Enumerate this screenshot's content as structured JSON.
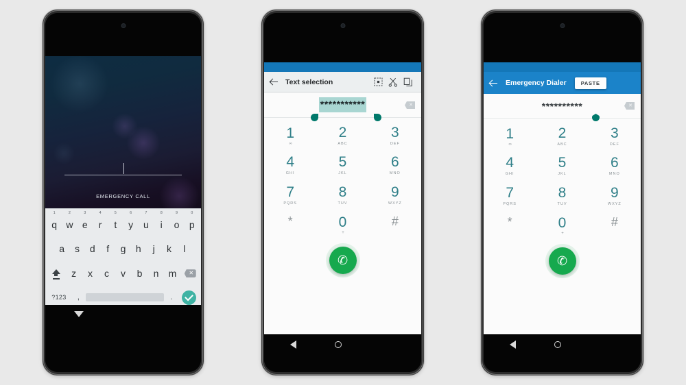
{
  "meta": {
    "background_color": "#e9e9e9",
    "accent_blue": "#1b83c9",
    "status_blue": "#1477b8",
    "dial_teal": "#2f7f88",
    "selection_highlight": "#a9d6d2",
    "handle_teal": "#00796b",
    "call_green": "#16a94e",
    "enter_teal": "#3fb3a4"
  },
  "phone1": {
    "name": "lockscreen-emergency-call",
    "lockscreen": {
      "pin_value": "",
      "pin_placeholder": "",
      "emergency_call_label": "EMERGENCY CALL"
    },
    "keyboard": {
      "row1": [
        {
          "key": "q",
          "num": "1"
        },
        {
          "key": "w",
          "num": "2"
        },
        {
          "key": "e",
          "num": "3"
        },
        {
          "key": "r",
          "num": "4"
        },
        {
          "key": "t",
          "num": "5"
        },
        {
          "key": "y",
          "num": "6"
        },
        {
          "key": "u",
          "num": "7"
        },
        {
          "key": "i",
          "num": "8"
        },
        {
          "key": "o",
          "num": "9"
        },
        {
          "key": "p",
          "num": "0"
        }
      ],
      "row2": [
        "a",
        "s",
        "d",
        "f",
        "g",
        "h",
        "j",
        "k",
        "l"
      ],
      "row3": [
        "z",
        "x",
        "c",
        "v",
        "b",
        "n",
        "m"
      ],
      "shift_label": "shift-key",
      "delete_label": "delete-key",
      "symbols_label": "?123",
      "comma_label": ",",
      "period_label": ".",
      "space_label": "space-key",
      "enter_label": "enter-key"
    },
    "navbar": {
      "hide_keyboard_label": "hide-keyboard"
    }
  },
  "phone2": {
    "name": "text-selection-dialer",
    "toolbar": {
      "title": "Text selection",
      "back_label": "back",
      "icons": [
        {
          "name": "select-all-icon",
          "label": "Select all"
        },
        {
          "name": "cut-icon",
          "label": "Cut"
        },
        {
          "name": "copy-icon",
          "label": "Copy"
        }
      ]
    },
    "numfield": {
      "value": "***********",
      "selected": true,
      "clear_label": "clear"
    },
    "dialpad": [
      {
        "num": "1",
        "sub": "",
        "vm": "∞"
      },
      {
        "num": "2",
        "sub": "ABC",
        "vm": ""
      },
      {
        "num": "3",
        "sub": "DEF",
        "vm": ""
      },
      {
        "num": "4",
        "sub": "GHI",
        "vm": ""
      },
      {
        "num": "5",
        "sub": "JKL",
        "vm": ""
      },
      {
        "num": "6",
        "sub": "MNO",
        "vm": ""
      },
      {
        "num": "7",
        "sub": "PQRS",
        "vm": ""
      },
      {
        "num": "8",
        "sub": "TUV",
        "vm": ""
      },
      {
        "num": "9",
        "sub": "WXYZ",
        "vm": ""
      },
      {
        "num": "*",
        "sub": "",
        "vm": "",
        "gray": true
      },
      {
        "num": "0",
        "sub": "",
        "vm": "+"
      },
      {
        "num": "#",
        "sub": "",
        "vm": "",
        "gray": true
      }
    ],
    "call_button_label": "✆",
    "navbar": {
      "back_label": "back",
      "home_label": "home"
    }
  },
  "phone3": {
    "name": "emergency-dialer-paste",
    "appbar": {
      "title": "Emergency Dialer",
      "back_label": "back",
      "paste_label": "PASTE"
    },
    "numfield": {
      "value": "**********",
      "selected": false,
      "clear_label": "clear"
    },
    "dialpad": [
      {
        "num": "1",
        "sub": "",
        "vm": "∞"
      },
      {
        "num": "2",
        "sub": "ABC",
        "vm": ""
      },
      {
        "num": "3",
        "sub": "DEF",
        "vm": ""
      },
      {
        "num": "4",
        "sub": "GHI",
        "vm": ""
      },
      {
        "num": "5",
        "sub": "JKL",
        "vm": ""
      },
      {
        "num": "6",
        "sub": "MNO",
        "vm": ""
      },
      {
        "num": "7",
        "sub": "PQRS",
        "vm": ""
      },
      {
        "num": "8",
        "sub": "TUV",
        "vm": ""
      },
      {
        "num": "9",
        "sub": "WXYZ",
        "vm": ""
      },
      {
        "num": "*",
        "sub": "",
        "vm": "",
        "gray": true
      },
      {
        "num": "0",
        "sub": "",
        "vm": "+"
      },
      {
        "num": "#",
        "sub": "",
        "vm": "",
        "gray": true
      }
    ],
    "call_button_label": "✆",
    "navbar": {
      "back_label": "back",
      "home_label": "home"
    }
  }
}
